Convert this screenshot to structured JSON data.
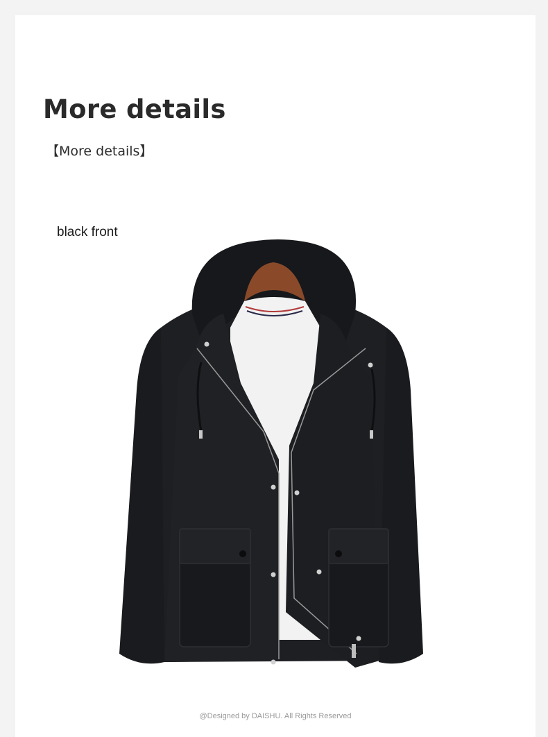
{
  "section": {
    "title": "More details",
    "subtitle": "【More details】"
  },
  "product": {
    "variant_label": "black front",
    "image_icon": "black-hooded-jacket-image",
    "colors": {
      "jacket": "#1c1d20",
      "shirt": "#f2f2f2",
      "hanger": "#8a4a2a"
    }
  },
  "footer": {
    "copyright": "@Designed by DAISHU. All Rights Reserved"
  }
}
